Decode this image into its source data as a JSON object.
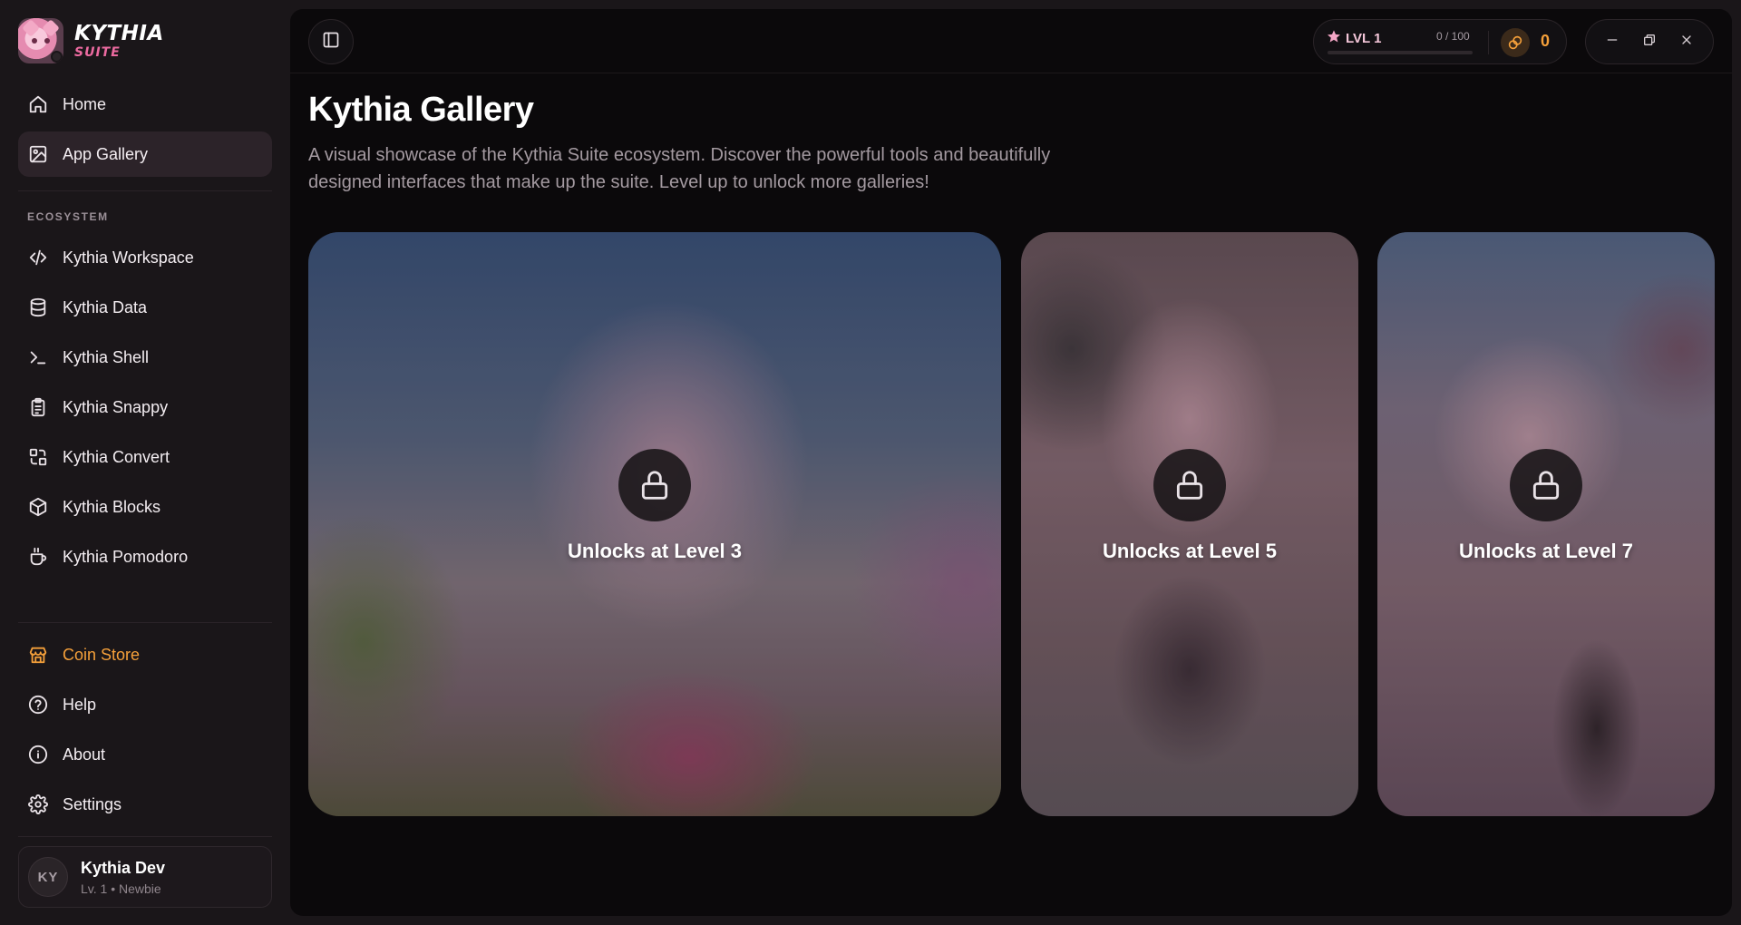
{
  "brand": {
    "title": "KYTHIA",
    "subtitle": "SUITE"
  },
  "sidebar": {
    "top_items": [
      {
        "label": "Home",
        "icon": "home-icon"
      },
      {
        "label": "App Gallery",
        "icon": "image-icon",
        "active": true
      }
    ],
    "section_label": "ECOSYSTEM",
    "ecosystem_items": [
      {
        "label": "Kythia Workspace",
        "icon": "code-icon"
      },
      {
        "label": "Kythia Data",
        "icon": "database-icon"
      },
      {
        "label": "Kythia Shell",
        "icon": "terminal-icon"
      },
      {
        "label": "Kythia Snappy",
        "icon": "clipboard-icon"
      },
      {
        "label": "Kythia Convert",
        "icon": "convert-icon"
      },
      {
        "label": "Kythia Blocks",
        "icon": "cube-icon"
      },
      {
        "label": "Kythia Pomodoro",
        "icon": "coffee-icon"
      }
    ],
    "bottom_items": [
      {
        "label": "Coin Store",
        "icon": "store-icon",
        "accent": "#f5a03a"
      },
      {
        "label": "Help",
        "icon": "help-icon"
      },
      {
        "label": "About",
        "icon": "info-icon"
      },
      {
        "label": "Settings",
        "icon": "gear-icon"
      }
    ],
    "profile": {
      "initials": "KY",
      "name": "Kythia Dev",
      "subtitle": "Lv. 1 • Newbie"
    }
  },
  "topbar": {
    "level_label": "LVL 1",
    "xp_text": "0 / 100",
    "xp_progress": 0,
    "coins": "0"
  },
  "main": {
    "title": "Kythia Gallery",
    "description": "A visual showcase of the Kythia Suite ecosystem. Discover the powerful tools and beautifully designed interfaces that make up the suite. Level up to unlock more galleries!",
    "cards": [
      {
        "lock_text": "Unlocks at Level 3"
      },
      {
        "lock_text": "Unlocks at Level 5"
      },
      {
        "lock_text": "Unlocks at Level 7"
      }
    ]
  },
  "colors": {
    "accent_pink": "#ec6aa0",
    "accent_orange": "#f5a03a",
    "panel_bg": "#0b090b",
    "sidebar_bg": "#1a1619"
  }
}
